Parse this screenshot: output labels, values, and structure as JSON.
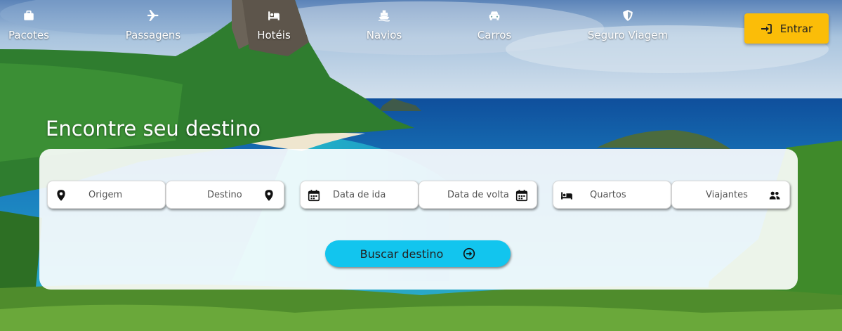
{
  "nav": {
    "items": [
      {
        "label": "Pacotes",
        "icon": "suitcase-icon"
      },
      {
        "label": "Passagens",
        "icon": "plane-icon"
      },
      {
        "label": "Hotéis",
        "icon": "bed-icon"
      },
      {
        "label": "Navios",
        "icon": "ship-icon"
      },
      {
        "label": "Carros",
        "icon": "car-icon"
      },
      {
        "label": "Seguro Viagem",
        "icon": "shield-icon"
      }
    ],
    "login_label": "Entrar"
  },
  "hero": {
    "headline": "Encontre seu destino"
  },
  "search": {
    "origin_placeholder": "Origem",
    "destination_placeholder": "Destino",
    "departure_placeholder": "Data de ida",
    "return_placeholder": "Data de volta",
    "rooms_placeholder": "Quartos",
    "travelers_placeholder": "Viajantes",
    "submit_label": "Buscar destino"
  },
  "colors": {
    "login_button": "#fbbd08",
    "search_button": "#12c5ee"
  }
}
